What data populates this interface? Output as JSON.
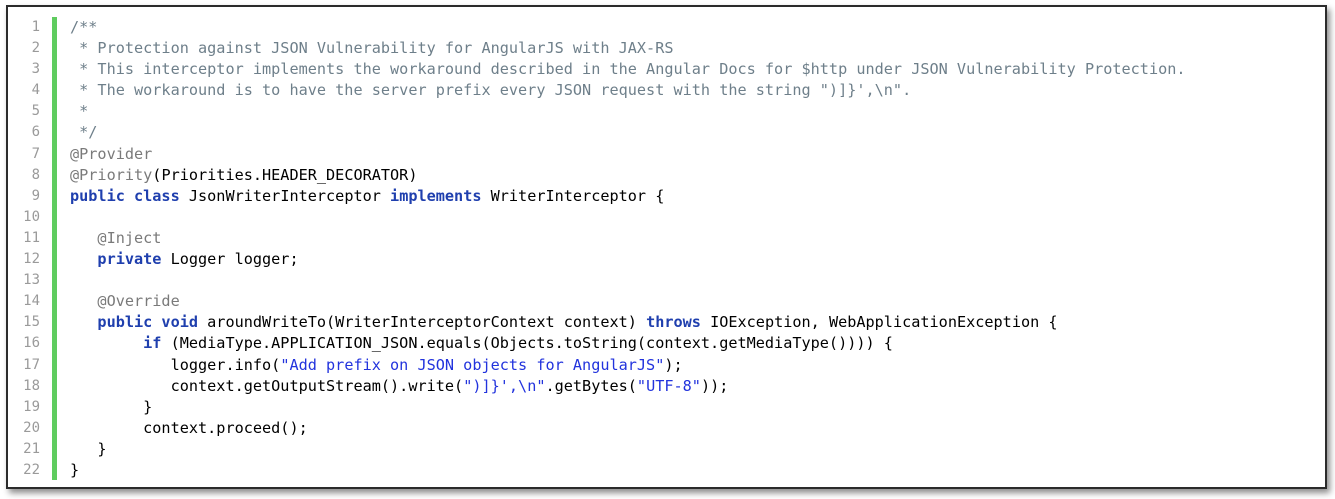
{
  "colors": {
    "comment": "#6e7f8a",
    "annotation": "#7a7a7a",
    "keyword": "#1f3fae",
    "string": "#2233dd",
    "plain": "#000000",
    "line_number": "#9a9a9a",
    "change_bar": "#5fcc5f"
  },
  "lines": [
    {
      "num": "1",
      "tokens": [
        {
          "t": "c",
          "v": "/**"
        }
      ]
    },
    {
      "num": "2",
      "tokens": [
        {
          "t": "c",
          "v": " * Protection against JSON Vulnerability for AngularJS with JAX-RS"
        }
      ]
    },
    {
      "num": "3",
      "tokens": [
        {
          "t": "c",
          "v": " * This interceptor implements the workaround described in the Angular Docs for $http under JSON Vulnerability Protection."
        }
      ]
    },
    {
      "num": "4",
      "tokens": [
        {
          "t": "c",
          "v": " * The workaround is to have the server prefix every JSON request with the string \")]}',\\n\"."
        }
      ]
    },
    {
      "num": "5",
      "tokens": [
        {
          "t": "c",
          "v": " *"
        }
      ]
    },
    {
      "num": "6",
      "tokens": [
        {
          "t": "c",
          "v": " */"
        }
      ]
    },
    {
      "num": "7",
      "tokens": [
        {
          "t": "a",
          "v": "@Provider"
        }
      ]
    },
    {
      "num": "8",
      "tokens": [
        {
          "t": "a",
          "v": "@Priority"
        },
        {
          "t": "p",
          "v": "(Priorities.HEADER_DECORATOR)"
        }
      ]
    },
    {
      "num": "9",
      "tokens": [
        {
          "t": "k",
          "v": "public class"
        },
        {
          "t": "p",
          "v": " JsonWriterInterceptor "
        },
        {
          "t": "k",
          "v": "implements"
        },
        {
          "t": "p",
          "v": " WriterInterceptor {"
        }
      ]
    },
    {
      "num": "10",
      "tokens": []
    },
    {
      "num": "11",
      "tokens": [
        {
          "t": "a",
          "v": "   @Inject"
        }
      ]
    },
    {
      "num": "12",
      "tokens": [
        {
          "t": "k",
          "v": "   private"
        },
        {
          "t": "p",
          "v": " Logger logger;"
        }
      ]
    },
    {
      "num": "13",
      "tokens": []
    },
    {
      "num": "14",
      "tokens": [
        {
          "t": "a",
          "v": "   @Override"
        }
      ]
    },
    {
      "num": "15",
      "tokens": [
        {
          "t": "k",
          "v": "   public void"
        },
        {
          "t": "p",
          "v": " aroundWriteTo(WriterInterceptorContext context) "
        },
        {
          "t": "k",
          "v": "throws"
        },
        {
          "t": "p",
          "v": " IOException, WebApplicationException {"
        }
      ]
    },
    {
      "num": "16",
      "tokens": [
        {
          "t": "k",
          "v": "        if"
        },
        {
          "t": "p",
          "v": " (MediaType.APPLICATION_JSON.equals(Objects.toString(context.getMediaType()))) {"
        }
      ]
    },
    {
      "num": "17",
      "tokens": [
        {
          "t": "p",
          "v": "           logger.info("
        },
        {
          "t": "s",
          "v": "\"Add prefix on JSON objects for AngularJS\""
        },
        {
          "t": "p",
          "v": ");"
        }
      ]
    },
    {
      "num": "18",
      "tokens": [
        {
          "t": "p",
          "v": "           context.getOutputStream().write("
        },
        {
          "t": "s",
          "v": "\")]}',\\n\""
        },
        {
          "t": "p",
          "v": ".getBytes("
        },
        {
          "t": "s",
          "v": "\"UTF-8\""
        },
        {
          "t": "p",
          "v": "));"
        }
      ]
    },
    {
      "num": "19",
      "tokens": [
        {
          "t": "p",
          "v": "        }"
        }
      ]
    },
    {
      "num": "20",
      "tokens": [
        {
          "t": "p",
          "v": "        context.proceed();"
        }
      ]
    },
    {
      "num": "21",
      "tokens": [
        {
          "t": "p",
          "v": "   }"
        }
      ]
    },
    {
      "num": "22",
      "tokens": [
        {
          "t": "p",
          "v": "}"
        }
      ]
    }
  ]
}
